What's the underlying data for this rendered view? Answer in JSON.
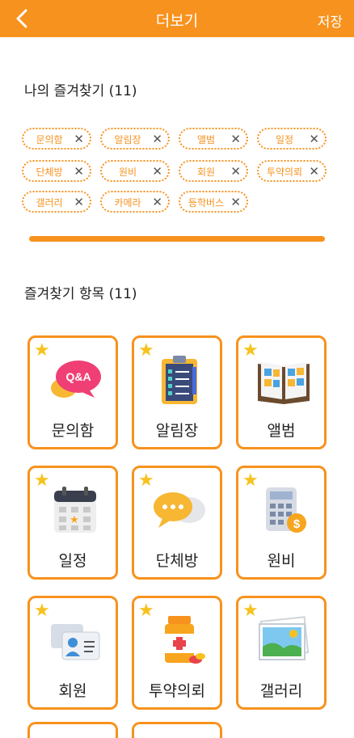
{
  "header": {
    "title": "더보기",
    "save_label": "저장"
  },
  "favorites": {
    "heading": "나의 즐겨찾기 (11)",
    "chips": [
      "문의함",
      "알림장",
      "앨범",
      "일정",
      "단체방",
      "원비",
      "회원",
      "투약의뢰",
      "갤러리",
      "카메라",
      "등학버스"
    ]
  },
  "items": {
    "heading": "즐겨찾기 항목 (11)",
    "cards": [
      {
        "label": "문의함",
        "icon": "qa-bubble-icon"
      },
      {
        "label": "알림장",
        "icon": "clipboard-checklist-icon"
      },
      {
        "label": "앨범",
        "icon": "photo-album-icon"
      },
      {
        "label": "일정",
        "icon": "calendar-icon"
      },
      {
        "label": "단체방",
        "icon": "group-chat-icon"
      },
      {
        "label": "원비",
        "icon": "calculator-fee-icon"
      },
      {
        "label": "회원",
        "icon": "member-cards-icon"
      },
      {
        "label": "투약의뢰",
        "icon": "medicine-bottle-icon"
      },
      {
        "label": "갤러리",
        "icon": "gallery-picture-icon"
      }
    ]
  },
  "colors": {
    "accent": "#f7921e",
    "star": "#f7c21e"
  }
}
